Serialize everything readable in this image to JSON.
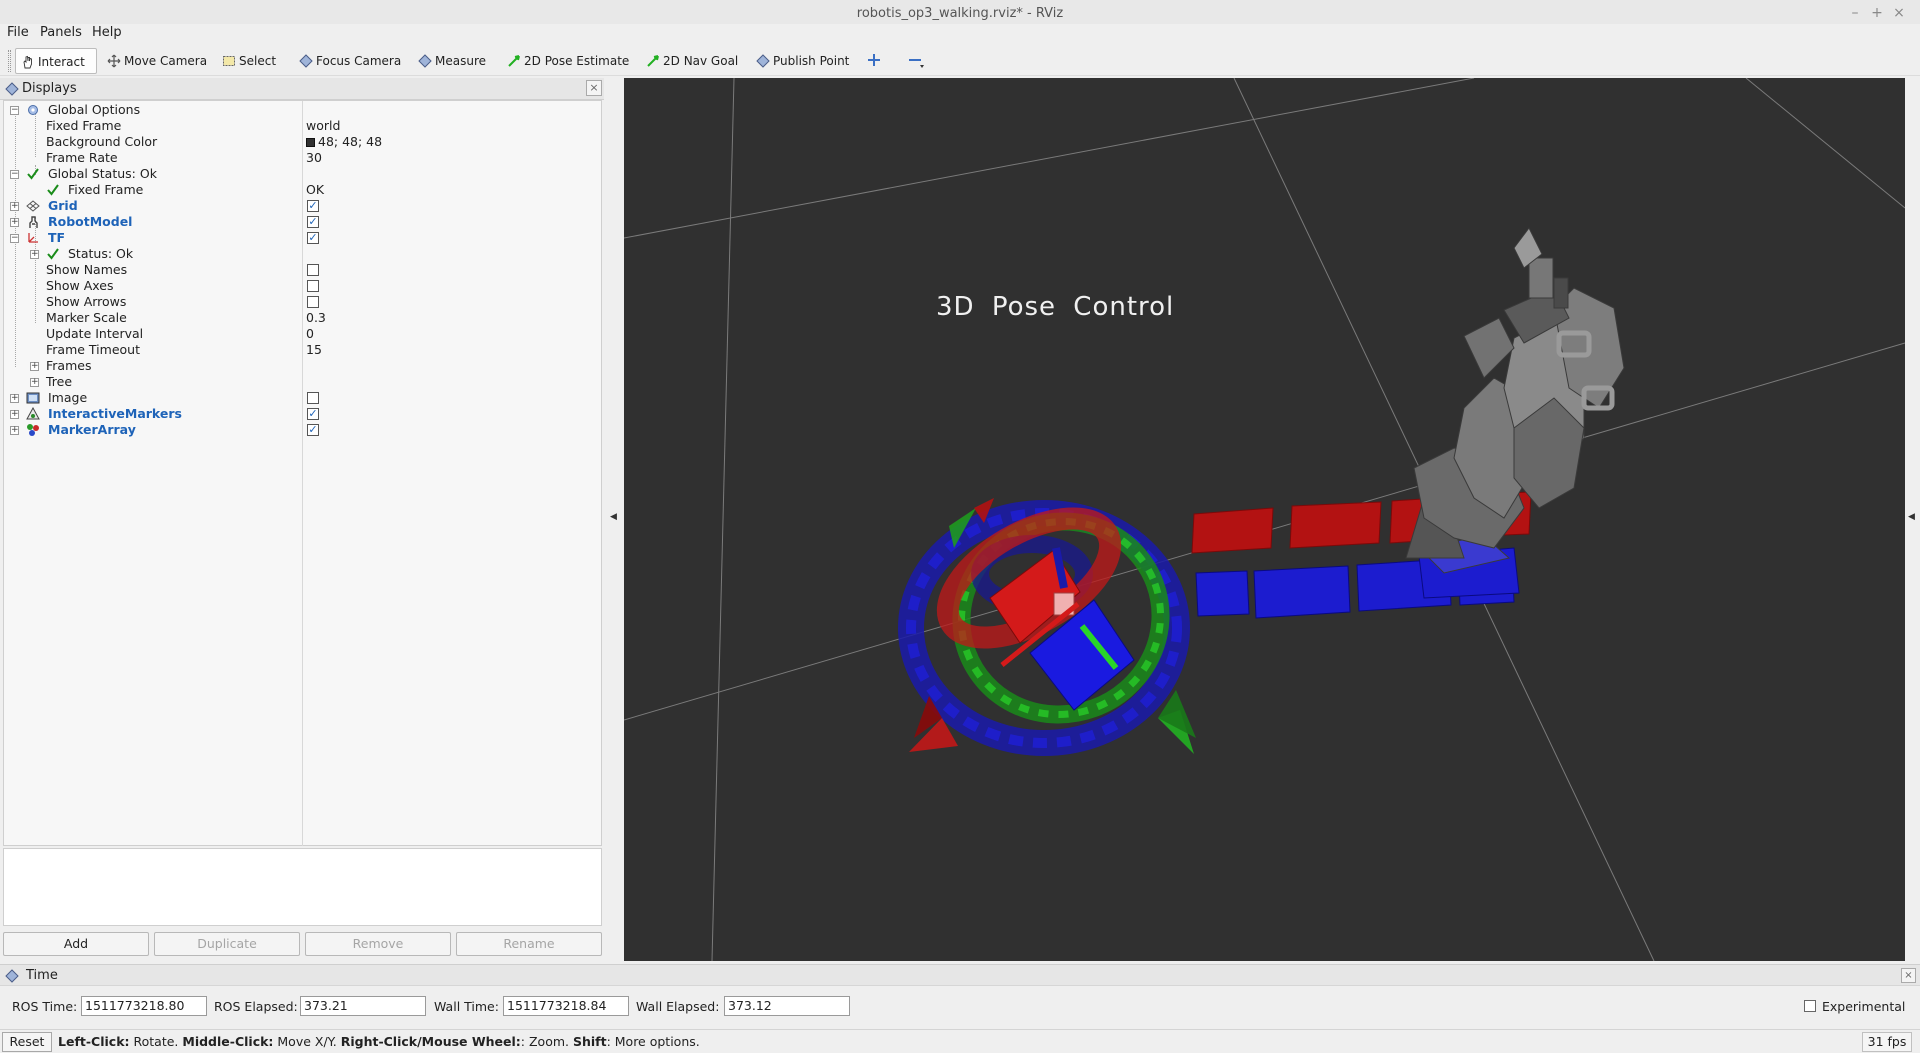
{
  "window": {
    "title": "robotis_op3_walking.rviz* - RViz"
  },
  "menu": [
    "File",
    "Panels",
    "Help"
  ],
  "toolbar": {
    "tools": [
      "Interact",
      "Move Camera",
      "Select",
      "Focus Camera",
      "Measure",
      "2D Pose Estimate",
      "2D Nav Goal",
      "Publish Point"
    ],
    "active": "Interact"
  },
  "displays": {
    "title": "Displays",
    "rows": [
      {
        "label": "Global Options",
        "value": ""
      },
      {
        "label": "Fixed Frame",
        "value": "world"
      },
      {
        "label": "Background Color",
        "value": "48; 48; 48"
      },
      {
        "label": "Frame Rate",
        "value": "30"
      },
      {
        "label": "Global Status: Ok",
        "value": ""
      },
      {
        "label": "Fixed Frame",
        "value": "OK"
      },
      {
        "label": "Grid",
        "checked": true
      },
      {
        "label": "RobotModel",
        "checked": true
      },
      {
        "label": "TF",
        "checked": true
      },
      {
        "label": "Status: Ok",
        "value": ""
      },
      {
        "label": "Show Names",
        "checked": false
      },
      {
        "label": "Show Axes",
        "checked": false
      },
      {
        "label": "Show Arrows",
        "checked": false
      },
      {
        "label": "Marker Scale",
        "value": "0.3"
      },
      {
        "label": "Update Interval",
        "value": "0"
      },
      {
        "label": "Frame Timeout",
        "value": "15"
      },
      {
        "label": "Frames",
        "value": ""
      },
      {
        "label": "Tree",
        "value": ""
      },
      {
        "label": "Image",
        "checked": false
      },
      {
        "label": "InteractiveMarkers",
        "checked": true
      },
      {
        "label": "MarkerArray",
        "checked": true
      }
    ],
    "buttons": {
      "add": "Add",
      "duplicate": "Duplicate",
      "remove": "Remove",
      "rename": "Rename"
    }
  },
  "viewport": {
    "overlay_text": "3D  Pose  Control",
    "background_color": "#303030"
  },
  "time": {
    "title": "Time",
    "ros_time_label": "ROS Time:",
    "ros_time": "1511773218.80",
    "ros_elapsed_label": "ROS Elapsed:",
    "ros_elapsed": "373.21",
    "wall_time_label": "Wall Time:",
    "wall_time": "1511773218.84",
    "wall_elapsed_label": "Wall Elapsed:",
    "wall_elapsed": "373.12",
    "experimental_label": "Experimental"
  },
  "status": {
    "reset": "Reset",
    "hint_left": "Left-Click:",
    "hint_left_txt": " Rotate. ",
    "hint_middle": "Middle-Click:",
    "hint_middle_txt": " Move X/Y. ",
    "hint_right": "Right-Click/Mouse Wheel:",
    "hint_right_txt": ": Zoom. ",
    "hint_shift": "Shift",
    "hint_shift_txt": ": More options.",
    "fps": "31 fps"
  }
}
